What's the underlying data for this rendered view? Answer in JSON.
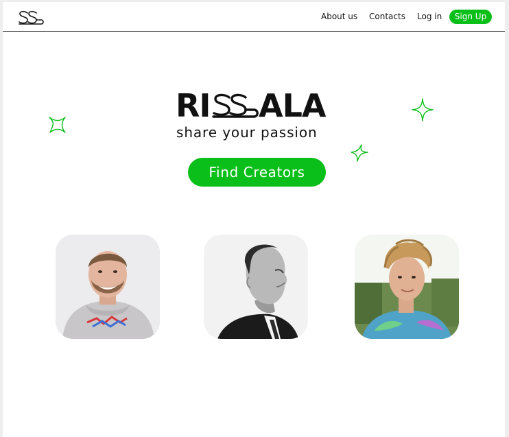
{
  "header": {
    "logo": "rissala-ss-logo",
    "nav": {
      "about_label": "About us",
      "contacts_label": "Contacts",
      "login_label": "Log in",
      "signup_label": "Sign Up"
    }
  },
  "hero": {
    "brand_left": "RI",
    "brand_right": "ALA",
    "tagline": "share your passion",
    "cta_label": "Find Creators"
  },
  "creators": [
    {
      "portrait": "smiling-man-grey-hoodie"
    },
    {
      "portrait": "man-profile-black-white"
    },
    {
      "portrait": "young-man-curly-hair"
    }
  ],
  "colors": {
    "accent": "#0bbf1a",
    "text": "#111111",
    "background": "#ffffff"
  }
}
